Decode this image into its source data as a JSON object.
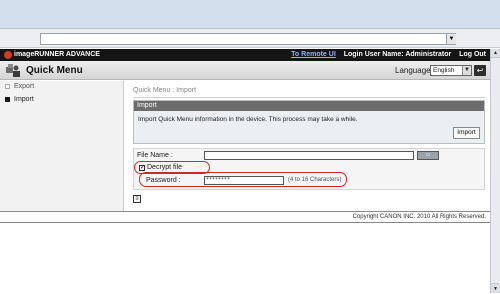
{
  "header": {
    "brand": "imageRUNNER ADVANCE",
    "remote_ui_link": "To Remote UI",
    "login_user": "Login User Name: Administrator",
    "logout_link": "Log Out"
  },
  "title_bar": {
    "title": "Quick Menu",
    "language_label": "Language",
    "language_value": "English"
  },
  "sidebar": {
    "items": [
      {
        "label": "Export"
      },
      {
        "label": "Import"
      }
    ]
  },
  "main": {
    "breadcrumb": "Quick Menu : Import",
    "import_panel": {
      "title": "Import",
      "description": "Import Quick Menu information in the device. This process may take a while.",
      "button_label": "Import"
    },
    "form": {
      "file_name_label": "File Name :",
      "decrypt_label": "Decrypt file",
      "decrypt_checked": true,
      "password_label": "Password :",
      "password_value": "********",
      "password_hint": "(4 to 16 Characters)"
    }
  },
  "footer": {
    "copyright": "Copyright CANON INC. 2010 All Rights Reserved."
  },
  "colors": {
    "header_bg": "#141414",
    "link": "#8fb3ff",
    "panel_title_bg": "#6c6c6c",
    "highlight_ring": "#cc2a2a"
  },
  "icons": {
    "quick_menu": "quick-menu-icon",
    "back": "back-arrow-icon",
    "browse": "browse-icon"
  }
}
